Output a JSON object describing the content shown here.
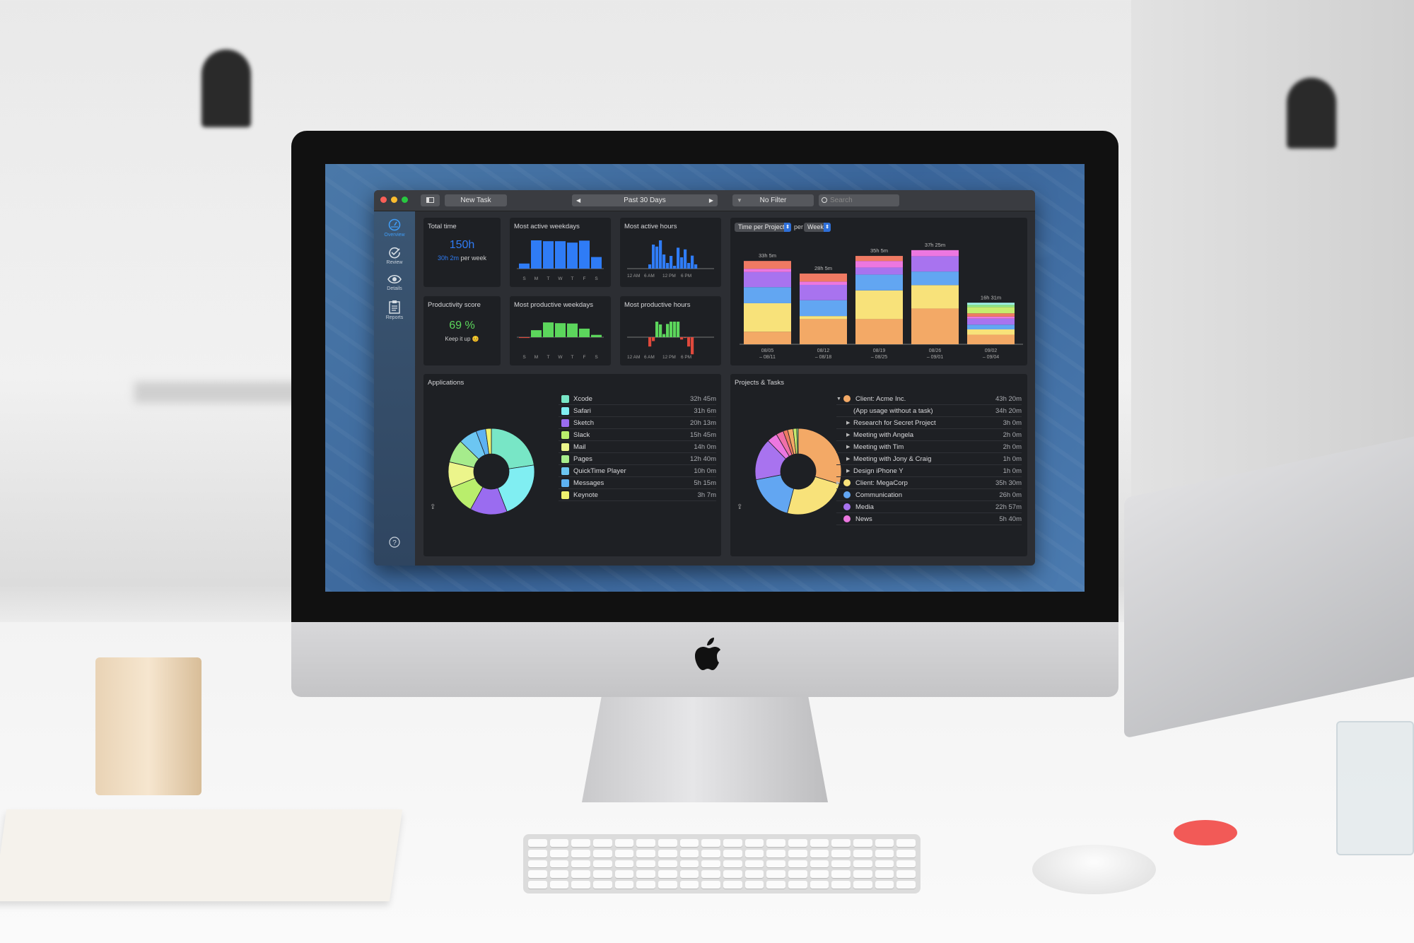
{
  "colors": {
    "accent": "#2f7cf6",
    "positive": "#5cd65c",
    "negative": "#e0493c",
    "card_bg": "#1e2024",
    "window_bg": "#2c2e33"
  },
  "toolbar": {
    "new_task": "New Task",
    "date_range": "Past 30 Days",
    "filter": "No Filter",
    "search_placeholder": "Search",
    "prev_icon": "triangle-left",
    "next_icon": "triangle-right",
    "filter_icon": "funnel",
    "search_icon": "magnifier",
    "sidebar_toggle_icon": "sidebar"
  },
  "sidebar": {
    "items": [
      {
        "label": "Overview",
        "icon": "speedometer",
        "active": true
      },
      {
        "label": "Review",
        "icon": "checkmark-circle"
      },
      {
        "label": "Details",
        "icon": "eye"
      },
      {
        "label": "Reports",
        "icon": "clipboard"
      }
    ],
    "help_icon": "question-circle"
  },
  "total_time": {
    "title": "Total time",
    "value": "150h",
    "per_week_value": "30h 2m",
    "per_week_suffix": "per week"
  },
  "productivity": {
    "title": "Productivity score",
    "value": "69 %",
    "message": "Keep it up 😊"
  },
  "chart_data": [
    {
      "id": "most-active-weekdays",
      "type": "bar",
      "title": "Most active weekdays",
      "categories": [
        "S",
        "M",
        "T",
        "W",
        "T",
        "F",
        "S"
      ],
      "values": [
        0.18,
        1.0,
        0.97,
        0.97,
        0.92,
        0.99,
        0.41
      ],
      "color": "#2f7cf6"
    },
    {
      "id": "most-active-hours",
      "type": "bar",
      "title": "Most active hours",
      "tick_labels": [
        "12 AM",
        "6 AM",
        "12 PM",
        "6 PM"
      ],
      "x": [
        0,
        1,
        2,
        3,
        4,
        5,
        6,
        7,
        8,
        9,
        10,
        11,
        12,
        13,
        14,
        15,
        16,
        17,
        18,
        19,
        20,
        21,
        22,
        23
      ],
      "values": [
        0,
        0,
        0,
        0,
        0,
        0,
        0.15,
        0.85,
        0.78,
        1.0,
        0.5,
        0.2,
        0.45,
        0.1,
        0.74,
        0.4,
        0.68,
        0.2,
        0.46,
        0.15,
        0,
        0,
        0,
        0
      ],
      "color": "#2f7cf6"
    },
    {
      "id": "most-productive-weekdays",
      "type": "bar",
      "title": "Most productive weekdays",
      "categories": [
        "S",
        "M",
        "T",
        "W",
        "T",
        "F",
        "S"
      ],
      "values": [
        -0.05,
        0.45,
        0.95,
        0.9,
        0.88,
        0.55,
        0.15
      ]
    },
    {
      "id": "most-productive-hours",
      "type": "bar",
      "title": "Most productive hours",
      "tick_labels": [
        "12 AM",
        "6 AM",
        "12 PM",
        "6 PM"
      ],
      "x": [
        0,
        1,
        2,
        3,
        4,
        5,
        6,
        7,
        8,
        9,
        10,
        11,
        12,
        13,
        14,
        15,
        16,
        17,
        18,
        19,
        20,
        21,
        22,
        23
      ],
      "values": [
        0,
        0,
        0,
        0,
        0,
        0,
        -0.6,
        -0.25,
        1.0,
        0.82,
        0.2,
        0.85,
        1.0,
        1.0,
        1.0,
        -0.15,
        -0.05,
        -0.6,
        -1.1,
        0,
        0,
        0,
        0,
        0
      ]
    },
    {
      "id": "time-per-project",
      "type": "stacked-bar",
      "selector": "Time per Project",
      "per_label": "per",
      "period": "Week",
      "categories": [
        [
          "08/05",
          "– 08/11"
        ],
        [
          "08/12",
          "– 08/18"
        ],
        [
          "08/19",
          "– 08/25"
        ],
        [
          "08/26",
          "– 09/01"
        ],
        [
          "09/02",
          "– 09/04"
        ]
      ],
      "totals": [
        "33h 5m",
        "28h 5m",
        "35h 5m",
        "37h 25m",
        "16h 31m"
      ],
      "series": [
        {
          "color": "#f3a966",
          "values": [
            5.0,
            10.0,
            10.0,
            14.2,
            3.8
          ]
        },
        {
          "color": "#f8e27a",
          "values": [
            11.3,
            1.2,
            11.4,
            9.3,
            2.1
          ]
        },
        {
          "color": "#62a6f2",
          "values": [
            6.4,
            6.3,
            6.3,
            5.4,
            1.9
          ]
        },
        {
          "color": "#a873ef",
          "values": [
            6.0,
            6.1,
            2.8,
            6.1,
            2.4
          ]
        },
        {
          "color": "#ec77e0",
          "values": [
            1.3,
            1.3,
            2.6,
            2.4,
            0.8
          ]
        },
        {
          "color": "#ef7a63",
          "values": [
            3.1,
            3.2,
            2.0,
            0,
            1.3
          ]
        },
        {
          "color": "#c6ec6e",
          "values": [
            0,
            0,
            0,
            0,
            2.5
          ]
        },
        {
          "color": "#8fe58a",
          "values": [
            0,
            0,
            0,
            0,
            0.9
          ]
        },
        {
          "color": "#9ff2e8",
          "values": [
            0,
            0,
            0,
            0,
            0.8
          ]
        }
      ]
    },
    {
      "id": "applications-donut",
      "type": "pie",
      "title": "Applications",
      "slices": [
        {
          "label": "Xcode",
          "time": "32h 45m",
          "value": 32.75,
          "color": "#78e6c6"
        },
        {
          "label": "Safari",
          "time": "31h 6m",
          "value": 31.1,
          "color": "#80eef2"
        },
        {
          "label": "Sketch",
          "time": "20h 13m",
          "value": 20.22,
          "color": "#9a6cf0"
        },
        {
          "label": "Slack",
          "time": "15h 45m",
          "value": 15.75,
          "color": "#b9ee6c"
        },
        {
          "label": "Mail",
          "time": "14h 0m",
          "value": 14.0,
          "color": "#ecf58b"
        },
        {
          "label": "Pages",
          "time": "12h 40m",
          "value": 12.67,
          "color": "#a6ec8c"
        },
        {
          "label": "QuickTime Player",
          "time": "10h 0m",
          "value": 10.0,
          "color": "#6cc6f2"
        },
        {
          "label": "Messages",
          "time": "5h 15m",
          "value": 5.25,
          "color": "#5db2f2"
        },
        {
          "label": "Keynote",
          "time": "3h 7m",
          "value": 3.12,
          "color": "#eff26f"
        }
      ]
    },
    {
      "id": "projects-donut",
      "type": "pie",
      "title": "Projects & Tasks",
      "slices": [
        {
          "value": 43.33,
          "color": "#f3a966"
        },
        {
          "value": 35.5,
          "color": "#f8e27a"
        },
        {
          "value": 26.0,
          "color": "#62a6f2"
        },
        {
          "value": 22.95,
          "color": "#a873ef"
        },
        {
          "value": 5.67,
          "color": "#ec77e0"
        },
        {
          "value": 4.0,
          "color": "#f06fa8"
        },
        {
          "value": 2.5,
          "color": "#ef7a63"
        },
        {
          "value": 3.0,
          "color": "#f3a966"
        },
        {
          "value": 2.0,
          "color": "#c6ec6e"
        },
        {
          "value": 0.8,
          "color": "#8fe58a"
        }
      ]
    }
  ],
  "projects": {
    "title": "Projects & Tasks",
    "rows": [
      {
        "label": "Client: Acme Inc.",
        "time": "43h 20m",
        "color": "#f3a966",
        "disclosure": "open",
        "indent": 0
      },
      {
        "label": "(App usage without a task)",
        "time": "34h 20m",
        "indent": 1
      },
      {
        "label": "Research for Secret Project",
        "time": "3h 0m",
        "disclosure": "closed",
        "indent": 1
      },
      {
        "label": "Meeting with Angela",
        "time": "2h 0m",
        "disclosure": "closed",
        "indent": 1
      },
      {
        "label": "Meeting with Tim",
        "time": "2h 0m",
        "disclosure": "closed",
        "indent": 1
      },
      {
        "label": "Meeting with Jony & Craig",
        "time": "1h 0m",
        "disclosure": "closed",
        "indent": 1
      },
      {
        "label": "Design iPhone Y",
        "time": "1h 0m",
        "disclosure": "closed",
        "indent": 1
      },
      {
        "label": "Client: MegaCorp",
        "time": "35h 30m",
        "color": "#f8e27a",
        "disclosure": "closed",
        "indent": 0
      },
      {
        "label": "Communication",
        "time": "26h 0m",
        "color": "#62a6f2",
        "indent": 0
      },
      {
        "label": "Media",
        "time": "22h 57m",
        "color": "#a873ef",
        "indent": 0
      },
      {
        "label": "News",
        "time": "5h 40m",
        "color": "#ec77e0",
        "indent": 0
      }
    ]
  },
  "share_icon": "share"
}
